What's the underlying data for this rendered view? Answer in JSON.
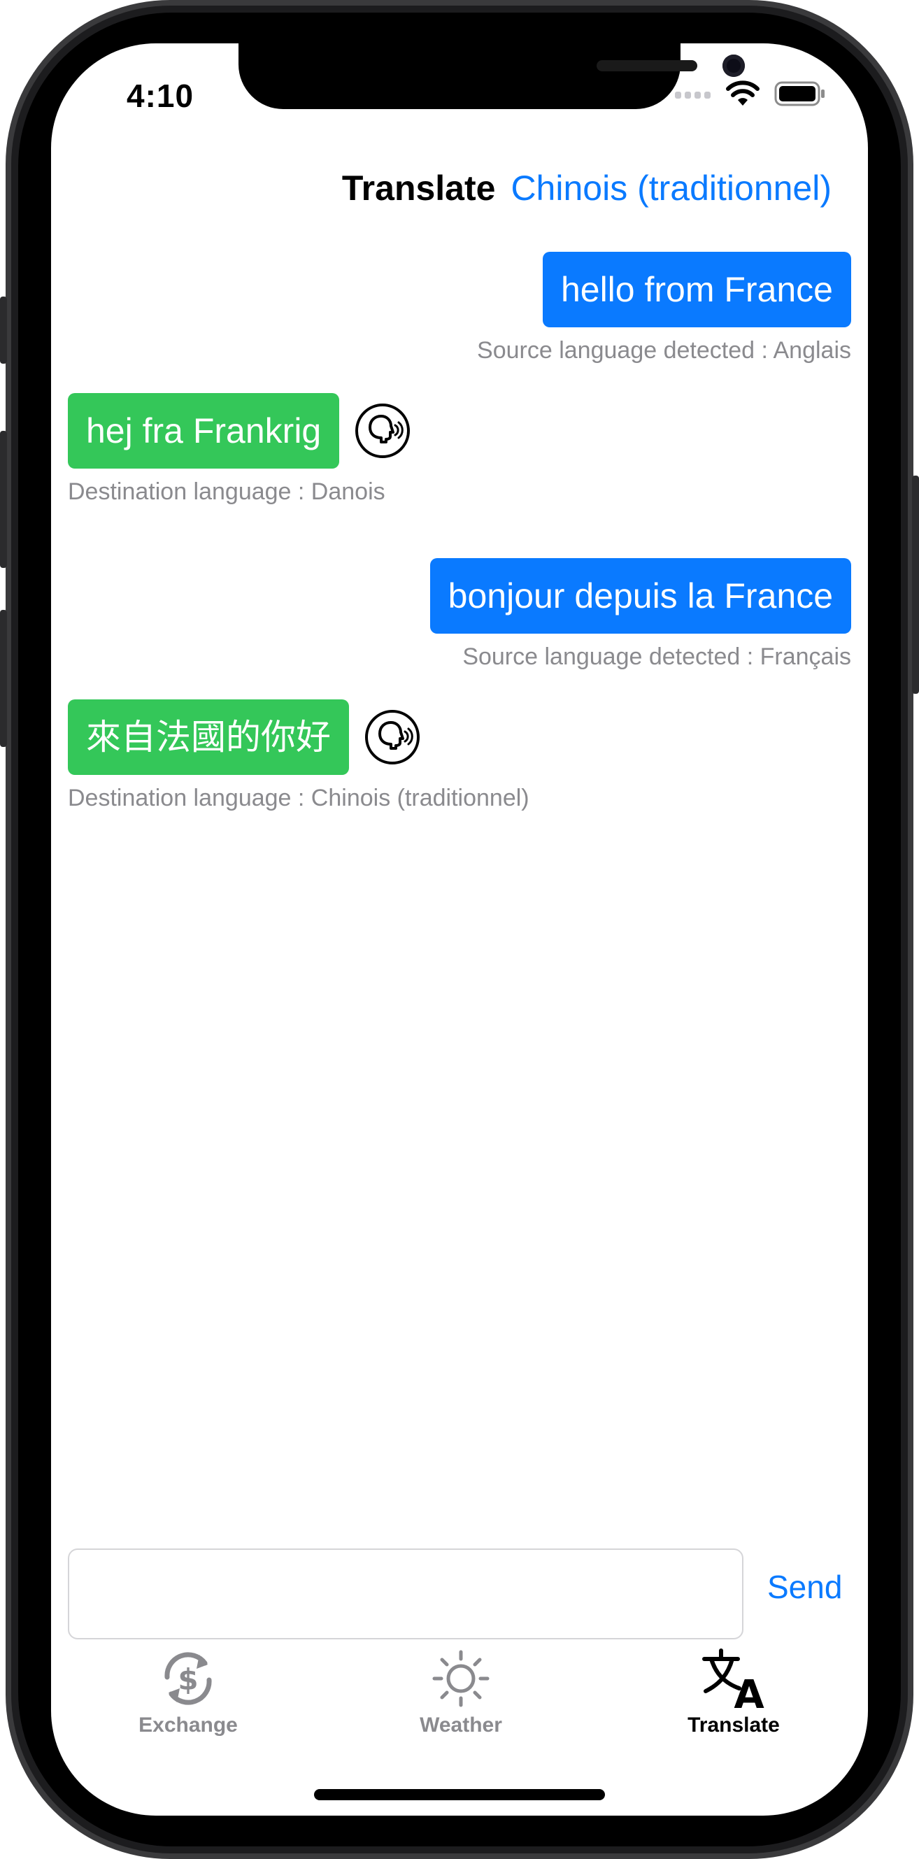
{
  "status_bar": {
    "time": "4:10"
  },
  "nav": {
    "title": "Translate",
    "language": "Chinois (traditionnel)"
  },
  "messages": [
    {
      "source_text": "hello from France",
      "source_caption": "Source language detected : Anglais",
      "translation": "hej fra Frankrig",
      "dest_caption": "Destination language : Danois"
    },
    {
      "source_text": "bonjour depuis la France",
      "source_caption": "Source language detected : Français",
      "translation": "來自法國的你好",
      "dest_caption": "Destination language : Chinois (traditionnel)"
    }
  ],
  "input": {
    "value": "",
    "placeholder": ""
  },
  "send_label": "Send",
  "tabs": [
    {
      "label": "Exchange",
      "icon": "exchange-icon",
      "selected": false
    },
    {
      "label": "Weather",
      "icon": "sun-icon",
      "selected": false
    },
    {
      "label": "Translate",
      "icon": "translate-icon",
      "selected": true
    }
  ],
  "colors": {
    "accent": "#0a7aff",
    "translation_bubble": "#34c759",
    "caption": "#8a8a8e",
    "tab_inactive": "#8a8a8e"
  }
}
